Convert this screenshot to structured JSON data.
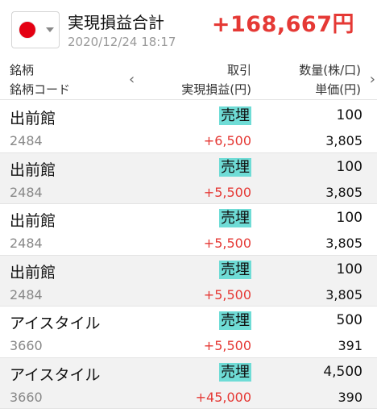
{
  "header": {
    "title": "実現損益合計",
    "datetime": "2020/12/24 18:17",
    "total": "+168,667円",
    "flag_color": "#e40012"
  },
  "columns": {
    "name": "銘柄",
    "code": "銘柄コード",
    "trade": "取引",
    "pl": "実現損益(円)",
    "qty": "数量(株/口)",
    "price": "単価(円)",
    "prev_icon": "chevron-left-icon",
    "next_icon": "chevron-right-icon"
  },
  "rows": [
    {
      "name": "出前館",
      "code": "2484",
      "trade": "売埋",
      "pl": "+6,500",
      "qty": "100",
      "price": "3,805"
    },
    {
      "name": "出前館",
      "code": "2484",
      "trade": "売埋",
      "pl": "+5,500",
      "qty": "100",
      "price": "3,805"
    },
    {
      "name": "出前館",
      "code": "2484",
      "trade": "売埋",
      "pl": "+5,500",
      "qty": "100",
      "price": "3,805"
    },
    {
      "name": "出前館",
      "code": "2484",
      "trade": "売埋",
      "pl": "+5,500",
      "qty": "100",
      "price": "3,805"
    },
    {
      "name": "アイスタイル",
      "code": "3660",
      "trade": "売埋",
      "pl": "+5,500",
      "qty": "500",
      "price": "391"
    },
    {
      "name": "アイスタイル",
      "code": "3660",
      "trade": "売埋",
      "pl": "+45,000",
      "qty": "4,500",
      "price": "390"
    }
  ],
  "colors": {
    "profit": "#e53935",
    "trade_highlight": "#6fdcd6",
    "alt_row": "#f2f2f2"
  }
}
